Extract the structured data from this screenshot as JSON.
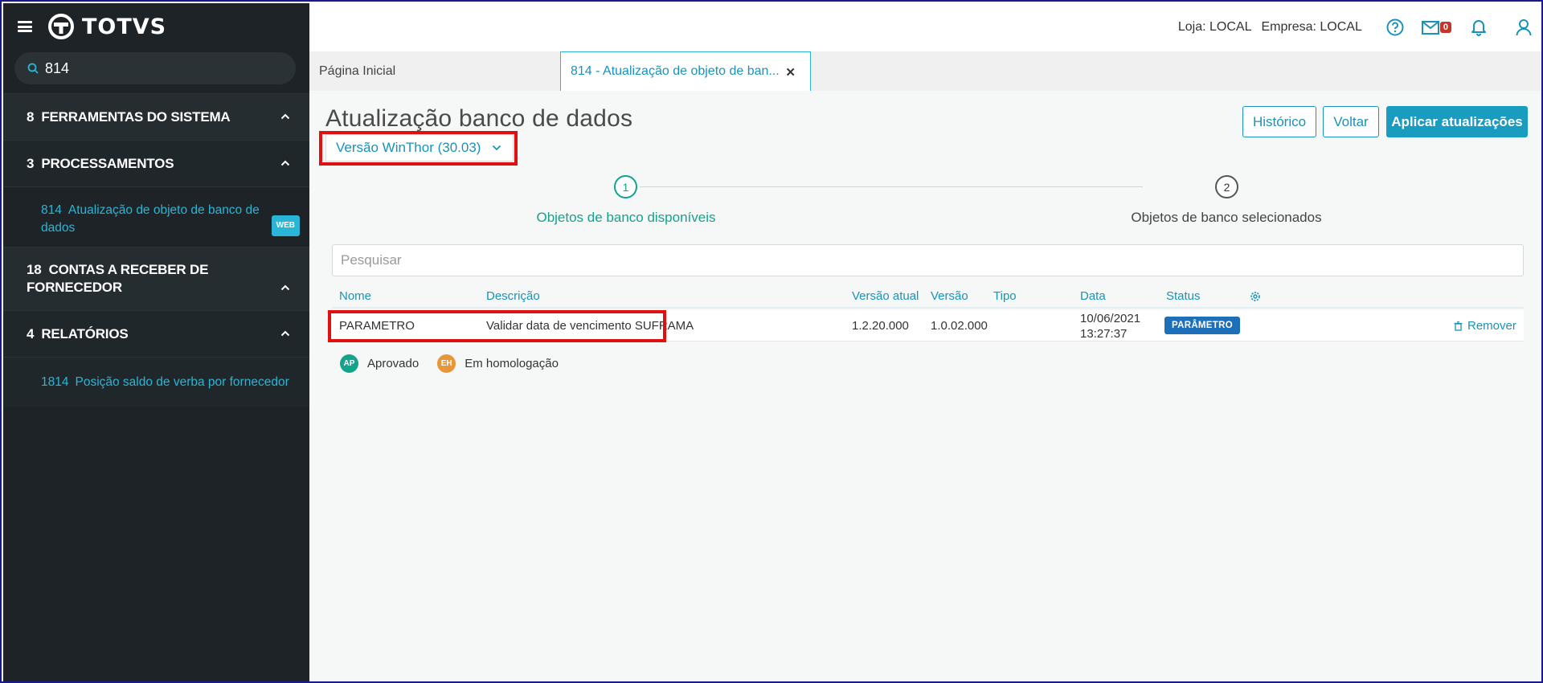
{
  "brand": {
    "name": "TOTVS"
  },
  "search": {
    "value": "814"
  },
  "sidebar": {
    "sections": [
      {
        "code": "8",
        "label": "FERRAMENTAS DO SISTEMA"
      },
      {
        "code": "3",
        "label": "PROCESSAMENTOS",
        "items": [
          {
            "code": "814",
            "label": "Atualização de objeto de banco de dados",
            "badge": "WEB"
          }
        ]
      },
      {
        "code": "18",
        "label": "CONTAS A RECEBER DE FORNECEDOR"
      },
      {
        "code": "4",
        "label": "RELATÓRIOS",
        "items": [
          {
            "code": "1814",
            "label": "Posição saldo de verba por fornecedor"
          }
        ]
      }
    ]
  },
  "topbar": {
    "store": "Loja: LOCAL",
    "company": "Empresa: LOCAL",
    "mail_count": "0"
  },
  "tabs": [
    {
      "label": "Página Inicial"
    },
    {
      "label": "814 - Atualização de objeto de ban..."
    }
  ],
  "page": {
    "title": "Atualização banco de dados",
    "version_select": "Versão WinThor (30.03)",
    "buttons": {
      "history": "Histórico",
      "back": "Voltar",
      "apply": "Aplicar atualizações"
    },
    "steps": [
      {
        "number": "1",
        "label": "Objetos de banco disponíveis"
      },
      {
        "number": "2",
        "label": "Objetos de banco selecionados"
      }
    ],
    "filter_placeholder": "Pesquisar"
  },
  "table": {
    "columns": [
      "Nome",
      "Descrição",
      "Versão atual",
      "Versão",
      "Tipo",
      "Data",
      "Status"
    ],
    "rows": [
      {
        "name": "PARAMETRO",
        "description": "Validar data de vencimento SUFRAMA",
        "current_version": "1.2.20.000",
        "version": "1.0.02.000",
        "type": "PARÂMETRO",
        "date": "10/06/2021",
        "time": "13:27:37",
        "status": "",
        "action": "Remover"
      }
    ]
  },
  "legend": [
    {
      "code": "AP",
      "label": "Aprovado",
      "color": "#14a38b"
    },
    {
      "code": "EH",
      "label": "Em homologação",
      "color": "#e8963a"
    }
  ],
  "colors": {
    "sidebar_bg": "#1d2327",
    "accent": "#1a93b8",
    "success": "#14a38b",
    "highlight": "#e01010"
  }
}
